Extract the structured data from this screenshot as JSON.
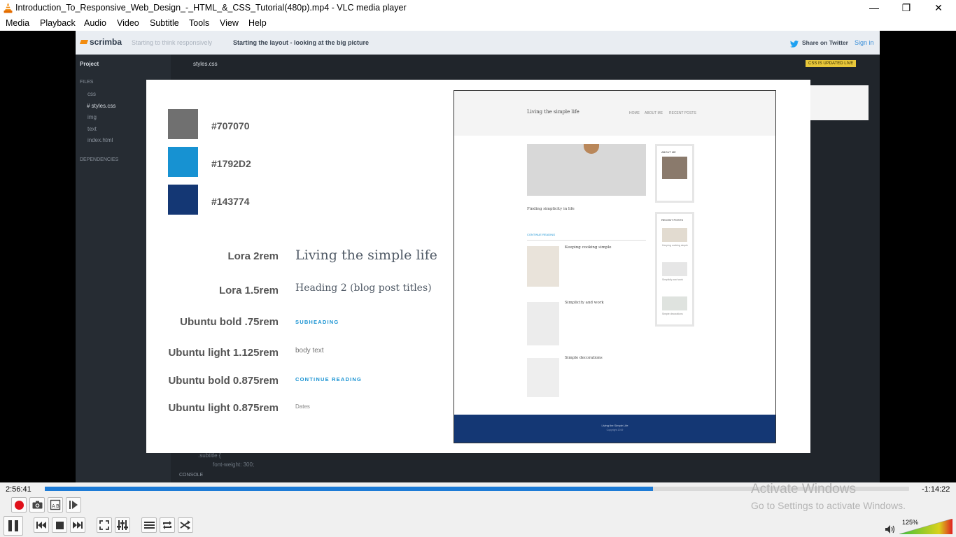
{
  "window": {
    "title": "Introduction_To_Responsive_Web_Design_-_HTML_&_CSS_Tutorial(480p).mp4 - VLC media player",
    "minimize": "—",
    "restore": "❐",
    "close": "✕"
  },
  "menu": [
    "Media",
    "Playback",
    "Audio",
    "Video",
    "Subtitle",
    "Tools",
    "View",
    "Help"
  ],
  "scrimba": {
    "logo": "scrimba",
    "breadcrumb_1": "Starting to think responsively",
    "breadcrumb_2": "Starting the layout - looking at the big picture",
    "share": "Share on Twitter",
    "signin": "Sign in",
    "project": "Project",
    "files": "FILES",
    "folder_css": "css",
    "file_styles": "# styles.css",
    "folder_img": "img",
    "folder_text": "text",
    "file_index": "index.html",
    "dependencies": "DEPENDENCIES",
    "tab": "styles.css",
    "badge": "CSS IS UPDATED LIVE",
    "code_1": ".subtitle {",
    "code_2": "font-weight: 300;",
    "console": "CONSOLE"
  },
  "slide": {
    "colors": [
      {
        "hex": "#707070",
        "color": "#707070"
      },
      {
        "hex": "#1792D2",
        "color": "#1792D2"
      },
      {
        "hex": "#143774",
        "color": "#143774"
      }
    ],
    "fonts": [
      {
        "label": "Lora 2rem",
        "sample": "Living the simple life"
      },
      {
        "label": "Lora 1.5rem",
        "sample": "Heading 2 (blog post titles)"
      },
      {
        "label": "Ubuntu bold .75rem",
        "sample": "SUBHEADING"
      },
      {
        "label": "Ubuntu light 1.125rem",
        "sample": "body text"
      },
      {
        "label": "Ubuntu bold 0.875rem",
        "sample": "CONTINUE READING"
      },
      {
        "label": "Ubuntu light 0.875rem",
        "sample": "Dates"
      }
    ]
  },
  "mockup": {
    "site_title": "Living the simple life",
    "nav": [
      "HOME",
      "ABOUT ME",
      "RECENT POSTS"
    ],
    "featured_title": "Finding simplicity in life",
    "continue": "CONTINUE READING",
    "posts": [
      "Keeping cooking simple",
      "Simplicity and work",
      "Simple decorations"
    ],
    "about": "ABOUT ME",
    "recent": "RECENT POSTS",
    "recent_posts": [
      "Keeping cooking simple",
      "Simplicity and work",
      "Simple decorations"
    ],
    "footer_title": "Living the Simple Life",
    "footer_copy": "Copyright 2019"
  },
  "player": {
    "elapsed": "2:56:41",
    "remaining": "-1:14:22",
    "progress": 0.704,
    "volume": "125%",
    "volume_level": 1.25
  },
  "watermark": {
    "line1": "Activate Windows",
    "line2": "Go to Settings to activate Windows."
  }
}
